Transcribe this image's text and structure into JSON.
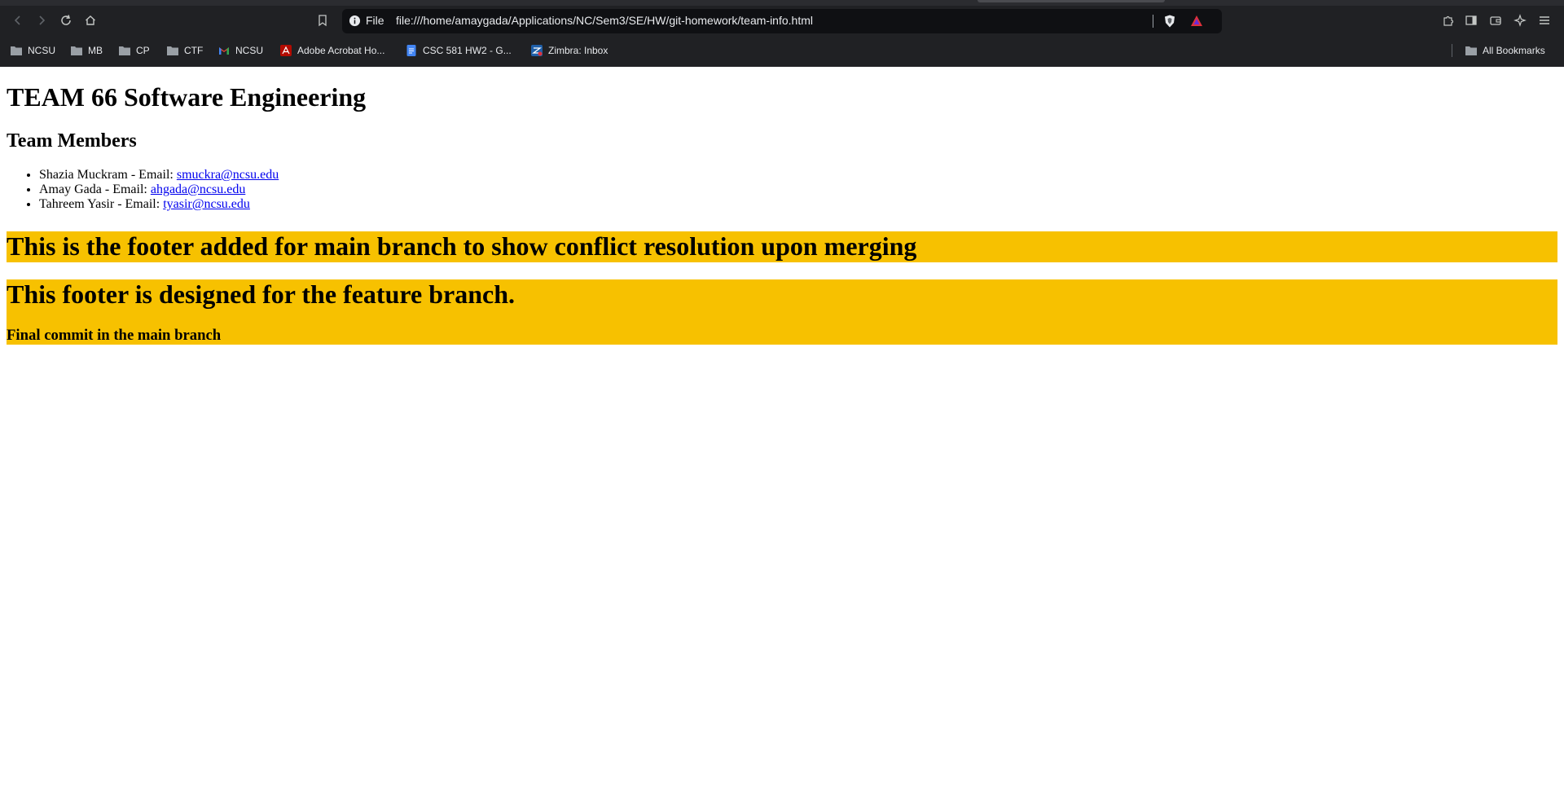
{
  "browser": {
    "scheme_label": "File",
    "url": "file:///home/amaygada/Applications/NC/Sem3/SE/HW/git-homework/team-info.html",
    "bookmarks": [
      {
        "label": "NCSU",
        "icon": "folder-icon"
      },
      {
        "label": "MB",
        "icon": "folder-icon"
      },
      {
        "label": "CP",
        "icon": "folder-icon"
      },
      {
        "label": "CTF",
        "icon": "folder-icon"
      },
      {
        "label": "NCSU",
        "icon": "gmail-icon"
      },
      {
        "label": "Adobe Acrobat Ho...",
        "icon": "acrobat-icon"
      },
      {
        "label": "CSC 581 HW2 - G...",
        "icon": "google-docs-icon"
      },
      {
        "label": "Zimbra: Inbox",
        "icon": "zimbra-icon"
      }
    ],
    "all_bookmarks_label": "All Bookmarks"
  },
  "page": {
    "title": "TEAM 66 Software Engineering",
    "members_heading": "Team Members",
    "members": [
      {
        "text": "Shazia Muckram - Email: ",
        "email": "smuckra@ncsu.edu"
      },
      {
        "text": "Amay Gada - Email: ",
        "email": "ahgada@ncsu.edu"
      },
      {
        "text": "Tahreem Yasir - Email: ",
        "email": "tyasir@ncsu.edu"
      }
    ],
    "footer_main": "This is the footer added for main branch to show conflict resolution upon merging",
    "footer_feature": "This footer is designed for the feature branch.",
    "final_commit": "Final commit in the main branch"
  },
  "colors": {
    "footer_bg": "#f7c100",
    "link": "#0000ee",
    "chrome_bg": "#202124"
  }
}
